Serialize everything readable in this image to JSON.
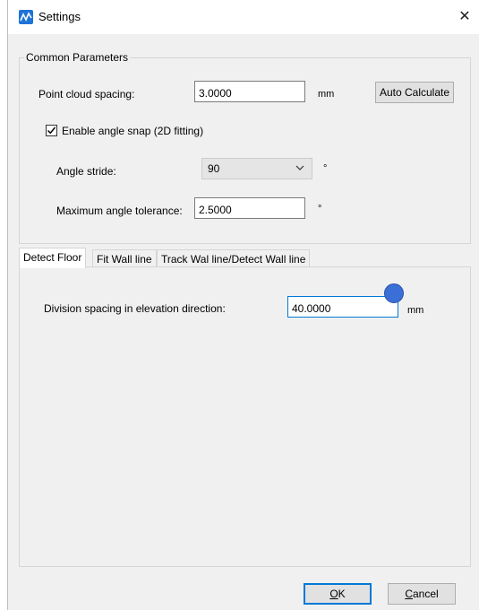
{
  "window": {
    "title": "Settings",
    "close_glyph": "✕",
    "icon": "app-logo-icon"
  },
  "common": {
    "group_label": "Common Parameters",
    "point_cloud_spacing_label": "Point cloud spacing:",
    "point_cloud_spacing_value": "3.0000",
    "point_cloud_spacing_unit": "mm",
    "auto_calculate_label": "Auto Calculate",
    "angle_snap_label": "Enable angle snap (2D fitting)",
    "angle_snap_checked": true,
    "angle_stride_label": "Angle stride:",
    "angle_stride_value": "90",
    "angle_stride_unit": "°",
    "max_angle_tol_label": "Maximum angle tolerance:",
    "max_angle_tol_value": "2.5000",
    "max_angle_tol_unit": "°"
  },
  "tabs": [
    {
      "label": "Detect Floor",
      "active": true
    },
    {
      "label": "Fit Wall line",
      "active": false
    },
    {
      "label": "Track Wal line/Detect Wall line",
      "active": false
    }
  ],
  "detect_floor": {
    "division_label": "Division spacing in elevation direction:",
    "division_value": "40.0000",
    "division_unit": "mm"
  },
  "buttons": {
    "ok_label_underlined": "O",
    "ok_label_rest": "K",
    "cancel_label_underlined": "C",
    "cancel_label_rest": "ancel"
  },
  "colors": {
    "accent": "#0078d7",
    "dialog_bg": "#f0f0f0",
    "cursor_dot": "#3a6fd8"
  }
}
